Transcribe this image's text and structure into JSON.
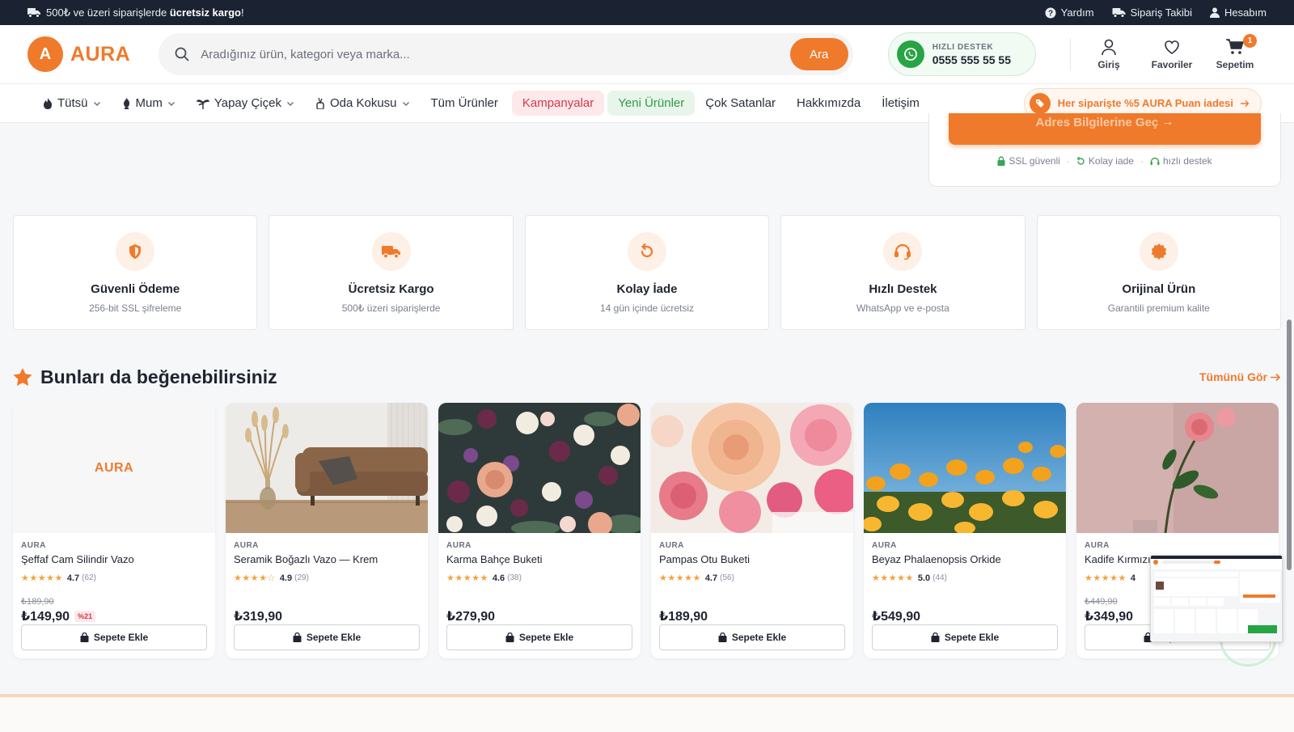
{
  "topbar": {
    "promo_prefix": "500₺ ve üzeri siparişlerde",
    "promo_bold": "ücretsiz kargo",
    "promo_suffix": "!",
    "links": [
      "Yardım",
      "Sipariş Takibi",
      "Hesabım"
    ]
  },
  "header": {
    "logo_letter": "A",
    "logo_text": "AURA",
    "search_placeholder": "Aradığınız ürün, kategori veya marka...",
    "search_button": "Ara",
    "support_label": "HIZLI DESTEK",
    "support_phone": "0555 555 55 55",
    "login": "Giriş",
    "favorites": "Favoriler",
    "cart": "Sepetim",
    "cart_count": "1"
  },
  "nav": {
    "items": [
      "Tütsü",
      "Mum",
      "Yapay Çiçek",
      "Oda Kokusu",
      "Tüm Ürünler",
      "Kampanyalar",
      "Yeni Ürünler",
      "Çok Satanlar",
      "Hakkımızda",
      "İletişim"
    ],
    "points_text": "Her siparişte %5 AURA Puan iadesi"
  },
  "checkout": {
    "button": "Adres Bilgilerine Geç",
    "trust": [
      "SSL güvenli",
      "Kolay iade",
      "hızlı destek"
    ]
  },
  "features": [
    {
      "title": "Güvenli Ödeme",
      "subtitle": "256-bit SSL şifreleme",
      "icon": "shield-icon"
    },
    {
      "title": "Ücretsiz Kargo",
      "subtitle": "500₺ üzeri siparişlerde",
      "icon": "truck-icon"
    },
    {
      "title": "Kolay İade",
      "subtitle": "14 gün içinde ücretsiz",
      "icon": "return-icon"
    },
    {
      "title": "Hızlı Destek",
      "subtitle": "WhatsApp ve e-posta",
      "icon": "headset-icon"
    },
    {
      "title": "Orijinal Ürün",
      "subtitle": "Garantili premium kalite",
      "icon": "badge-icon"
    }
  ],
  "recommendations": {
    "title": "Bunları da beğenebilirsiniz",
    "see_all": "Tümünü Gör",
    "add_to_cart": "Sepete Ekle",
    "products": [
      {
        "brand": "AURA",
        "name": "Şeffaf Cam Silindir Vazo",
        "rating": "4.7",
        "count": "(62)",
        "old_price": "₺189,90",
        "price": "₺149,90",
        "discount": "%21",
        "placeholder": "AURA"
      },
      {
        "brand": "AURA",
        "name": "Seramik Boğazlı Vazo — Krem",
        "rating": "4.9",
        "count": "(29)",
        "old_price": "",
        "price": "₺319,90",
        "discount": ""
      },
      {
        "brand": "AURA",
        "name": "Karma Bahçe Buketi",
        "rating": "4.6",
        "count": "(38)",
        "old_price": "",
        "price": "₺279,90",
        "discount": ""
      },
      {
        "brand": "AURA",
        "name": "Pampas Otu Buketi",
        "rating": "4.7",
        "count": "(56)",
        "old_price": "",
        "price": "₺189,90",
        "discount": ""
      },
      {
        "brand": "AURA",
        "name": "Beyaz Phalaenopsis Orkide",
        "rating": "5.0",
        "count": "(44)",
        "old_price": "",
        "price": "₺549,90",
        "discount": ""
      },
      {
        "brand": "AURA",
        "name": "Kadife Kırmızı",
        "rating": "4",
        "count": "",
        "old_price": "₺449,90",
        "price": "₺349,90",
        "discount": ""
      }
    ]
  },
  "colors": {
    "accent": "#ef7a2c",
    "topbar": "#1b2333",
    "success": "#27a444",
    "danger": "#d23a4b"
  }
}
